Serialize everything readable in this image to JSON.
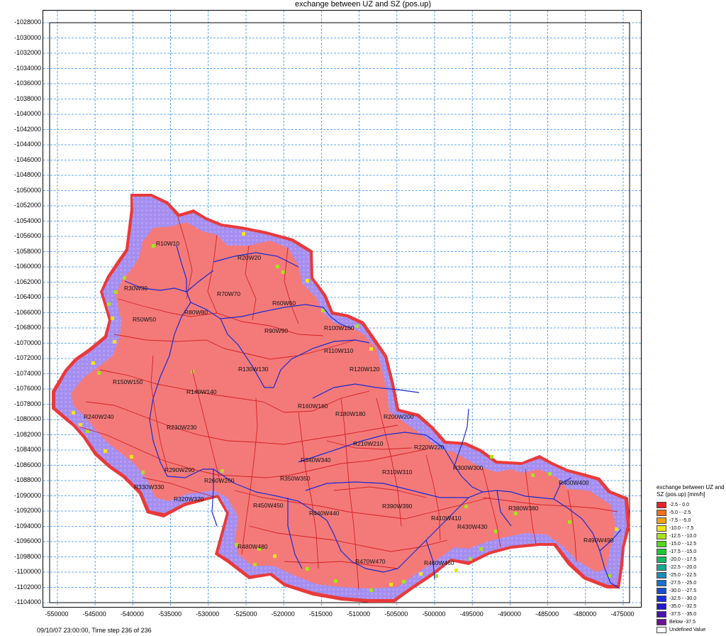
{
  "title": "exchange between UZ and SZ (pos.up)",
  "status": "09/10/07 23:00:00, Time step 236 of 236",
  "y_ticks": [
    "-1028000",
    "-1030000",
    "-1032000",
    "-1034000",
    "-1036000",
    "-1038000",
    "-1040000",
    "-1042000",
    "-1044000",
    "-1046000",
    "-1048000",
    "-1050000",
    "-1052000",
    "-1054000",
    "-1056000",
    "-1058000",
    "-1060000",
    "-1062000",
    "-1064000",
    "-1066000",
    "-1068000",
    "-1070000",
    "-1072000",
    "-1074000",
    "-1076000",
    "-1078000",
    "-1080000",
    "-1082000",
    "-1084000",
    "-1086000",
    "-1088000",
    "-1090000",
    "-1092000",
    "-1094000",
    "-1096000",
    "-1098000",
    "-1100000",
    "-1102000",
    "-1104000"
  ],
  "x_ticks": [
    "-550000",
    "-545000",
    "-540000",
    "-535000",
    "-530000",
    "-525000",
    "-520000",
    "-515000",
    "-510000",
    "-505000",
    "-500000",
    "-495000",
    "-490000",
    "-485000",
    "-480000",
    "-475000"
  ],
  "labels": [
    "R10W10",
    "R20W20",
    "R30W30",
    "R70W70",
    "R60W60",
    "R80W80",
    "R50W50",
    "R90W90",
    "R100W100",
    "R110W110",
    "R120W120",
    "R130W130",
    "R150W150",
    "R140W140",
    "R160W160",
    "R180W180",
    "R200W200",
    "R240W240",
    "R230W230",
    "R210W210",
    "R220W220",
    "R340W340",
    "R300W300",
    "R290W290",
    "R310W310",
    "R330W330",
    "R260W260",
    "R350W350",
    "R400W400",
    "R320W320",
    "R450W450",
    "R390W390",
    "R440W440",
    "R410W410",
    "R380W380",
    "R430W430",
    "R490W490",
    "R480W480",
    "R470W470",
    "R460W460"
  ],
  "legend": {
    "title": "exchange between UZ and SZ (pos.up) [mm/h]",
    "items": [
      {
        "label": "-2.5 -   0.0",
        "color": "#e8222a"
      },
      {
        "label": "-5.0 -  -2.5",
        "color": "#f07020"
      },
      {
        "label": "-7.5 -  -5.0",
        "color": "#f4a21a"
      },
      {
        "label": "-10.0 -  -7.5",
        "color": "#f2e418"
      },
      {
        "label": "-12.5 - -10.0",
        "color": "#a8e21c"
      },
      {
        "label": "-15.0 - -12.5",
        "color": "#52d81e"
      },
      {
        "label": "-17.5 - -15.0",
        "color": "#1ec832"
      },
      {
        "label": "-20.0 - -17.5",
        "color": "#1ab866"
      },
      {
        "label": "-22.5 - -20.0",
        "color": "#18a894"
      },
      {
        "label": "-25.0 - -22.5",
        "color": "#1a90b4"
      },
      {
        "label": "-27.5 - -25.0",
        "color": "#1c70c8"
      },
      {
        "label": "-30.0 - -27.5",
        "color": "#1c4ed2"
      },
      {
        "label": "-32.5 - -30.0",
        "color": "#1c2ed8"
      },
      {
        "label": "-35.0 - -32.5",
        "color": "#2418c8"
      },
      {
        "label": "-37.5 - -35.0",
        "color": "#4a14b0"
      },
      {
        "label": "Below  -37.5",
        "color": "#6e1290"
      },
      {
        "label": "Undefined Value",
        "color": "#ffffff"
      }
    ]
  },
  "colors": {
    "grid": "#3a8ee6",
    "catchment_fill": "#f47a7a",
    "edge_fill": "#a48ef0",
    "rivers": "#1a2ad0",
    "subcatchments": "#d42020"
  }
}
